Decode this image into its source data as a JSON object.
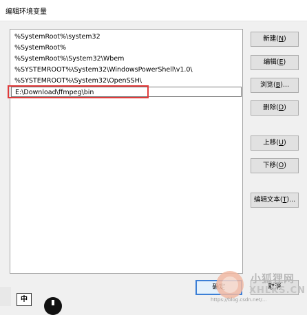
{
  "window": {
    "title": "编辑环境变量"
  },
  "path_list": {
    "items": [
      "%SystemRoot%\\system32",
      "%SystemRoot%",
      "%SystemRoot%\\System32\\Wbem",
      "%SYSTEMROOT%\\System32\\WindowsPowerShell\\v1.0\\",
      "%SYSTEMROOT%\\System32\\OpenSSH\\",
      "E:\\Download\\ffmpeg\\bin"
    ],
    "editing_index": 5,
    "highlight_color": "#e03a3a"
  },
  "buttons": {
    "new": {
      "text": "新建(",
      "key": "N",
      "suffix": ")"
    },
    "edit": {
      "text": "编辑(",
      "key": "E",
      "suffix": ")"
    },
    "browse": {
      "text": "浏览(",
      "key": "B",
      "suffix": ")..."
    },
    "delete": {
      "text": "删除(",
      "key": "D",
      "suffix": ")"
    },
    "move_up": {
      "text": "上移(",
      "key": "U",
      "suffix": ")"
    },
    "move_down": {
      "text": "下移(",
      "key": "O",
      "suffix": ")"
    },
    "edit_text": {
      "text": "编辑文本(",
      "key": "T",
      "suffix": ")..."
    },
    "ok": "确定",
    "cancel": "取消"
  },
  "taskbar": {
    "ime_label": "中"
  },
  "watermark": {
    "cn": "小狐狸网",
    "en": "XHLKS.CN",
    "site": "https://blog.csdn.net/..."
  }
}
